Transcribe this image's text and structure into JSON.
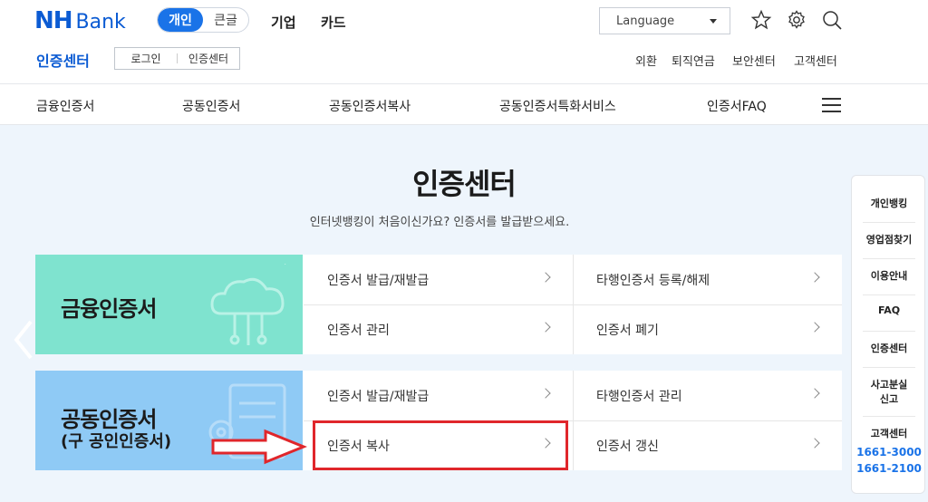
{
  "header": {
    "logo_nh": "NH",
    "logo_bank": "Bank",
    "toggle": {
      "on": "개인",
      "off": "큰글"
    },
    "links": [
      "기업",
      "카드"
    ],
    "language": "Language",
    "sub_title": "인증센터",
    "sub_buttons": [
      "로그인",
      "인증센터"
    ],
    "util": [
      "외환",
      "퇴직연금",
      "보안센터",
      "고객센터"
    ],
    "icons": [
      "star-icon",
      "gear-icon",
      "search-icon"
    ]
  },
  "gnb": {
    "items": [
      "금융인증서",
      "공동인증서",
      "공동인증서복사",
      "공동인증서특화서비스",
      "인증서FAQ"
    ]
  },
  "main": {
    "title": "인증센터",
    "desc": "인터넷뱅킹이 처음이신가요? 인증서를 발급받으세요.",
    "card1": {
      "title": "금융인증서",
      "items": [
        "인증서 발급/재발급",
        "타행인증서 등록/해제",
        "인증서 관리",
        "인증서 폐기"
      ]
    },
    "card2": {
      "title": "공동인증서",
      "subtitle": "(구 공인인증서)",
      "items": [
        "인증서 발급/재발급",
        "타행인증서 관리",
        "인증서 복사",
        "인증서 갱신"
      ]
    }
  },
  "quick": {
    "items": [
      "개인뱅킹",
      "영업점찾기",
      "이용안내",
      "FAQ",
      "인증센터",
      "사고분실",
      "신고",
      "고객센터"
    ],
    "phones": [
      "1661-3000",
      "1661-2100"
    ]
  },
  "colors": {
    "brand": "#0b5bd3",
    "accent": "#1a73e8",
    "card1_banner": "#7fe3cf",
    "card2_banner": "#8fcaf5",
    "highlight": "#e0262b"
  }
}
